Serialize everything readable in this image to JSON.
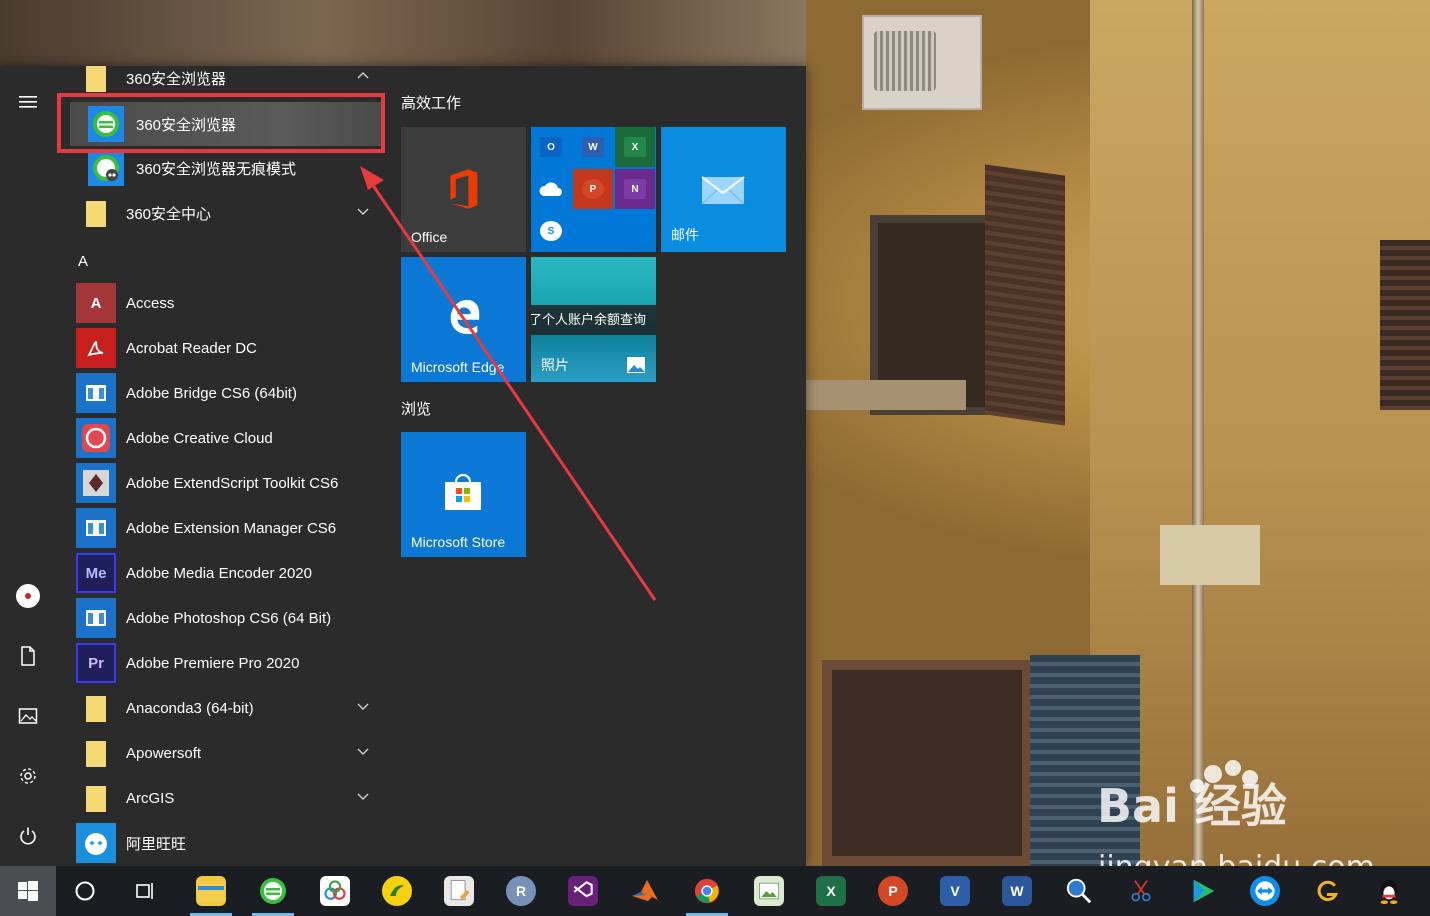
{
  "start_menu": {
    "apps": [
      {
        "label": "360安全浏览器",
        "type": "folder",
        "expanded": true
      },
      {
        "label": "360安全浏览器",
        "type": "app",
        "selected": true
      },
      {
        "label": "360安全浏览器无痕模式",
        "type": "app"
      },
      {
        "label": "360安全中心",
        "type": "folder"
      },
      {
        "label": "A",
        "type": "letter"
      },
      {
        "label": "Access",
        "type": "app",
        "icon_text": "A"
      },
      {
        "label": "Acrobat Reader DC",
        "type": "app"
      },
      {
        "label": "Adobe Bridge CS6 (64bit)",
        "type": "app"
      },
      {
        "label": "Adobe Creative Cloud",
        "type": "app"
      },
      {
        "label": "Adobe ExtendScript Toolkit CS6",
        "type": "app"
      },
      {
        "label": "Adobe Extension Manager CS6",
        "type": "app"
      },
      {
        "label": "Adobe Media Encoder 2020",
        "type": "app",
        "icon_text": "Me"
      },
      {
        "label": "Adobe Photoshop CS6 (64 Bit)",
        "type": "app"
      },
      {
        "label": "Adobe Premiere Pro 2020",
        "type": "app",
        "icon_text": "Pr"
      },
      {
        "label": "Anaconda3 (64-bit)",
        "type": "folder"
      },
      {
        "label": "Apowersoft",
        "type": "folder"
      },
      {
        "label": "ArcGIS",
        "type": "folder"
      },
      {
        "label": "阿里旺旺",
        "type": "app"
      }
    ],
    "groups": {
      "work": "高效工作",
      "browse": "浏览"
    },
    "tiles": {
      "office": "Office",
      "mail": "邮件",
      "edge": "Microsoft Edge",
      "photos_live": "了个人账户余额查询",
      "photos": "照片",
      "store": "Microsoft Store",
      "office_minis": [
        "O",
        "W",
        "X",
        "P",
        "N",
        "S"
      ]
    }
  },
  "watermark": {
    "text": "jingyan.baidu.com",
    "brand": "Bai 经验"
  },
  "taskbar": {
    "items": [
      "search",
      "task-view",
      "file-explorer",
      "360-browser",
      "baidu-netdisk",
      "wps",
      "document",
      "r",
      "visual-studio",
      "matlab",
      "chrome",
      "photo-viewer",
      "excel",
      "powerpoint",
      "visio",
      "word",
      "magnifier",
      "scissors",
      "player",
      "teamviewer",
      "g-app",
      "qq"
    ],
    "glyphs": {
      "r": "R",
      "excel": "X",
      "powerpoint": "P",
      "visio": "V",
      "word": "W"
    }
  },
  "colors": {
    "accent": "#0078d7",
    "highlight_box": "#e8393e"
  }
}
